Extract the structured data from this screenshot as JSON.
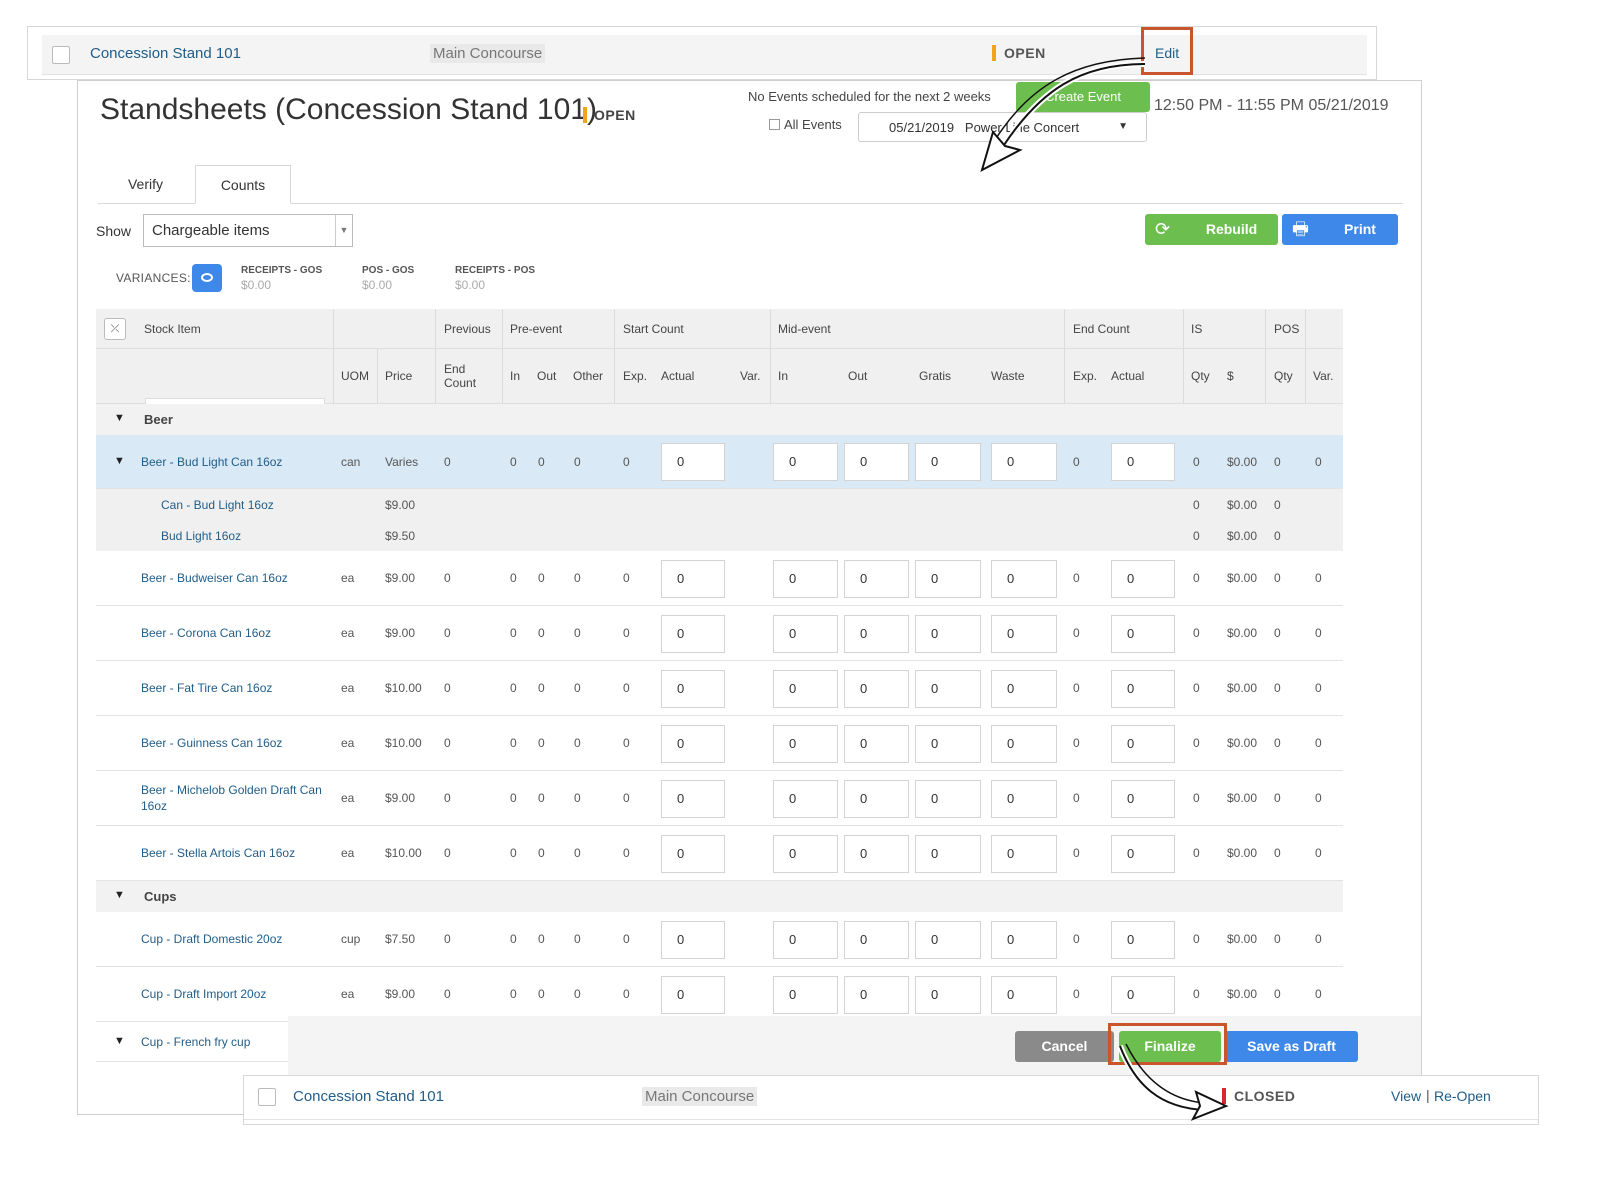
{
  "top_row": {
    "stand_name": "Concession Stand 101",
    "location": "Main Concourse",
    "status": "OPEN",
    "edit_label": "Edit"
  },
  "panel": {
    "title": "Standsheets (Concession Stand 101)",
    "status": "OPEN",
    "no_events_text": "No Events scheduled for the next 2 weeks",
    "create_event_label": "Create Event",
    "time_range": "12:50 PM - 11:55 PM 05/21/2019",
    "all_events_label": "All Events",
    "event_select_value": "05/21/2019   Power Line Concert",
    "tabs": [
      {
        "label": "Verify"
      },
      {
        "label": "Counts"
      }
    ],
    "active_tab": "Counts",
    "show_label": "Show",
    "show_value": "Chargeable items",
    "rebuild_label": "Rebuild",
    "print_label": "Print",
    "variances_label": "VARIANCES:",
    "variances": [
      {
        "label": "RECEIPTS - GOS",
        "value": "$0.00"
      },
      {
        "label": "POS - GOS",
        "value": "$0.00"
      },
      {
        "label": "RECEIPTS - POS",
        "value": "$0.00"
      }
    ]
  },
  "grid": {
    "header_top": {
      "stock_item": "Stock Item",
      "previous": "Previous",
      "pre_event": "Pre-event",
      "start_count": "Start Count",
      "mid_event": "Mid-event",
      "end_count": "End Count",
      "is": "IS",
      "pos": "POS"
    },
    "header_sub": {
      "uom": "UOM",
      "price": "Price",
      "end_count": "End Count",
      "in": "In",
      "out": "Out",
      "other": "Other",
      "exp": "Exp.",
      "actual": "Actual",
      "var": "Var.",
      "mid_in": "In",
      "mid_out": "Out",
      "gratis": "Gratis",
      "waste": "Waste",
      "end_exp": "Exp.",
      "end_actual": "Actual",
      "is_qty": "Qty",
      "is_dollar": "$",
      "pos_qty": "Qty",
      "pos_var": "Var."
    },
    "groups": [
      {
        "name": "Beer",
        "items": [
          {
            "name": "Beer - Bud Light Can 16oz",
            "uom": "can",
            "price": "Varies",
            "prev": "0",
            "in": "0",
            "out": "0",
            "other": "0",
            "exp": "0",
            "actual": "0",
            "mid_in": "0",
            "mid_out": "0",
            "gratis": "0",
            "waste": "0",
            "end_exp": "0",
            "end_actual": "0",
            "is_qty": "0",
            "is_dollar": "$0.00",
            "pos_qty": "0",
            "pos_var": "0",
            "children": [
              {
                "name": "Can - Bud Light 16oz",
                "price": "$9.00",
                "is_qty": "0",
                "is_dollar": "$0.00",
                "pos_qty": "0"
              },
              {
                "name": "Bud Light 16oz",
                "price": "$9.50",
                "is_qty": "0",
                "is_dollar": "$0.00",
                "pos_qty": "0"
              }
            ]
          },
          {
            "name": "Beer - Budweiser Can 16oz",
            "uom": "ea",
            "price": "$9.00",
            "prev": "0",
            "in": "0",
            "out": "0",
            "other": "0",
            "exp": "0",
            "actual": "0",
            "mid_in": "0",
            "mid_out": "0",
            "gratis": "0",
            "waste": "0",
            "end_exp": "0",
            "end_actual": "0",
            "is_qty": "0",
            "is_dollar": "$0.00",
            "pos_qty": "0",
            "pos_var": "0"
          },
          {
            "name": "Beer - Corona Can 16oz",
            "uom": "ea",
            "price": "$9.00",
            "prev": "0",
            "in": "0",
            "out": "0",
            "other": "0",
            "exp": "0",
            "actual": "0",
            "mid_in": "0",
            "mid_out": "0",
            "gratis": "0",
            "waste": "0",
            "end_exp": "0",
            "end_actual": "0",
            "is_qty": "0",
            "is_dollar": "$0.00",
            "pos_qty": "0",
            "pos_var": "0"
          },
          {
            "name": "Beer - Fat Tire Can 16oz",
            "uom": "ea",
            "price": "$10.00",
            "prev": "0",
            "in": "0",
            "out": "0",
            "other": "0",
            "exp": "0",
            "actual": "0",
            "mid_in": "0",
            "mid_out": "0",
            "gratis": "0",
            "waste": "0",
            "end_exp": "0",
            "end_actual": "0",
            "is_qty": "0",
            "is_dollar": "$0.00",
            "pos_qty": "0",
            "pos_var": "0"
          },
          {
            "name": "Beer - Guinness Can 16oz",
            "uom": "ea",
            "price": "$10.00",
            "prev": "0",
            "in": "0",
            "out": "0",
            "other": "0",
            "exp": "0",
            "actual": "0",
            "mid_in": "0",
            "mid_out": "0",
            "gratis": "0",
            "waste": "0",
            "end_exp": "0",
            "end_actual": "0",
            "is_qty": "0",
            "is_dollar": "$0.00",
            "pos_qty": "0",
            "pos_var": "0"
          },
          {
            "name": "Beer - Michelob Golden Draft Can 16oz",
            "uom": "ea",
            "price": "$9.00",
            "prev": "0",
            "in": "0",
            "out": "0",
            "other": "0",
            "exp": "0",
            "actual": "0",
            "mid_in": "0",
            "mid_out": "0",
            "gratis": "0",
            "waste": "0",
            "end_exp": "0",
            "end_actual": "0",
            "is_qty": "0",
            "is_dollar": "$0.00",
            "pos_qty": "0",
            "pos_var": "0"
          },
          {
            "name": "Beer - Stella Artois Can 16oz",
            "uom": "ea",
            "price": "$10.00",
            "prev": "0",
            "in": "0",
            "out": "0",
            "other": "0",
            "exp": "0",
            "actual": "0",
            "mid_in": "0",
            "mid_out": "0",
            "gratis": "0",
            "waste": "0",
            "end_exp": "0",
            "end_actual": "0",
            "is_qty": "0",
            "is_dollar": "$0.00",
            "pos_qty": "0",
            "pos_var": "0"
          }
        ]
      },
      {
        "name": "Cups",
        "items": [
          {
            "name": "Cup - Draft Domestic 20oz",
            "uom": "cup",
            "price": "$7.50",
            "prev": "0",
            "in": "0",
            "out": "0",
            "other": "0",
            "exp": "0",
            "actual": "0",
            "mid_in": "0",
            "mid_out": "0",
            "gratis": "0",
            "waste": "0",
            "end_exp": "0",
            "end_actual": "0",
            "is_qty": "0",
            "is_dollar": "$0.00",
            "pos_qty": "0",
            "pos_var": "0"
          },
          {
            "name": "Cup - Draft Import 20oz",
            "uom": "ea",
            "price": "$9.00",
            "prev": "0",
            "in": "0",
            "out": "0",
            "other": "0",
            "exp": "0",
            "actual": "0",
            "mid_in": "0",
            "mid_out": "0",
            "gratis": "0",
            "waste": "0",
            "end_exp": "0",
            "end_actual": "0",
            "is_qty": "0",
            "is_dollar": "$0.00",
            "pos_qty": "0",
            "pos_var": "0"
          },
          {
            "name": "Cup - French fry cup"
          }
        ]
      }
    ]
  },
  "footer": {
    "cancel_label": "Cancel",
    "finalize_label": "Finalize",
    "save_draft_label": "Save as Draft"
  },
  "bottom_row": {
    "stand_name": "Concession Stand 101",
    "location": "Main Concourse",
    "status": "CLOSED",
    "view_label": "View",
    "separator": "|",
    "reopen_label": "Re-Open"
  },
  "colors": {
    "link": "#1f5d8a",
    "green": "#6cbf4f",
    "blue": "#3e88e9",
    "open_accent": "#f0a31b",
    "closed_accent": "#d9262c",
    "callout": "#c8552c"
  },
  "icons": [
    "checkbox-icon",
    "refresh-icon",
    "printer-icon",
    "eye-icon",
    "collapse-icon",
    "caret-down-icon",
    "triangle-down-icon",
    "curved-arrow-icon"
  ]
}
